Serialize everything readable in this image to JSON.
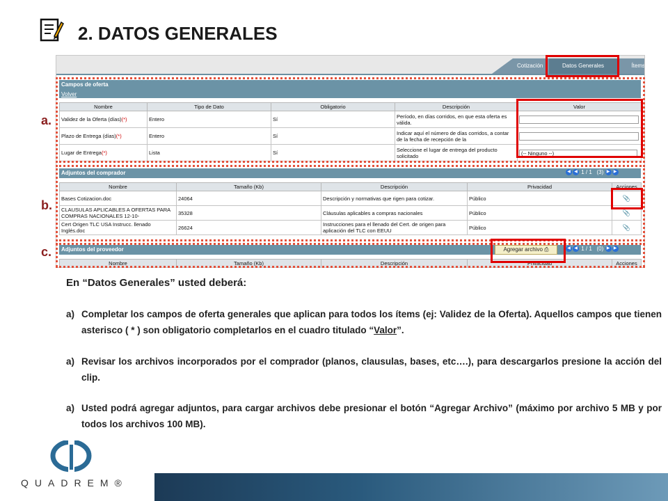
{
  "header": {
    "title": "2. DATOS GENERALES",
    "icon": "notepad-pencil-icon"
  },
  "tabs": {
    "cotizacion": "Cotización",
    "datos_generales": "Datos Generales",
    "items": "Ítems"
  },
  "campos": {
    "section_title": "Campos de oferta",
    "back_link": "Volver",
    "columns": [
      "Nombre",
      "Tipo de Dato",
      "Obligatorio",
      "Descripción",
      "Valor"
    ],
    "rows": [
      {
        "name": "Validez de la Oferta (días)",
        "req": "(*)",
        "type": "Entero",
        "mandatory": "Sí",
        "desc": "Período, en días corridos, en que esta oferta es válida.",
        "value": ""
      },
      {
        "name": "Plazo de Entrega (días)",
        "req": "(*)",
        "type": "Entero",
        "mandatory": "Sí",
        "desc": "Indicar aquí el número de días corridos, a contar de la fecha de recepción de la",
        "value": ""
      },
      {
        "name": "Lugar de Entrega",
        "req": "(*)",
        "type": "Lista",
        "mandatory": "Sí",
        "desc": "Seleccione el lugar de entrega del producto solicitado",
        "value": "(-- Ninguno --)"
      }
    ]
  },
  "adjuntos_comprador": {
    "section_title": "Adjuntos del comprador",
    "pager": "1 / 1",
    "count": "(3)",
    "columns": [
      "Nombre",
      "Tamaño (Kb)",
      "Descripción",
      "Privacidad",
      "Acciones"
    ],
    "rows": [
      {
        "name": "Bases Cotizacion.doc",
        "size": "24064",
        "desc": "Descripción y normativas que rigen para cotizar.",
        "privacy": "Público"
      },
      {
        "name": "CLAUSULAS APLICABLES A OFERTAS PARA COMPRAS NACIONALES 12-10-",
        "size": "35328",
        "desc": "Cláusulas aplicables a compras nacionales",
        "privacy": "Público"
      },
      {
        "name": "Cert Origen TLC USA Instrucc. llenado Inglés.doc",
        "size": "26624",
        "desc": "Instrucciones para el llenado del Cert. de origen para aplicación del TLC con EEUU",
        "privacy": "Público"
      }
    ]
  },
  "adjuntos_proveedor": {
    "section_title": "Adjuntos del proveedor",
    "add_button": "Agregar archivo",
    "pager": "1 / 1",
    "count": "(0)",
    "columns": [
      "Nombre",
      "Tamaño (Kb)",
      "Descripción",
      "Privacidad",
      "Acciones"
    ]
  },
  "labels": {
    "a": "a.",
    "b": "b.",
    "c": "c."
  },
  "content": {
    "subtitle": "En “Datos Generales” usted deberá:",
    "bullet_marker": "a)",
    "bullet1_pre": "Completar los campos de oferta generales que aplican para todos los ítems (ej: Validez de la Oferta). Aquellos campos que tienen asterisco ( * ) son obligatorio completarlos en el cuadro titulado “",
    "bullet1_link": "Valor",
    "bullet1_post": "”.",
    "bullet2": "Revisar los archivos incorporados por el comprador (planos, clausulas, bases, etc….), para descargarlos presione la acción del clip.",
    "bullet3": "Usted podrá agregar adjuntos, para cargar archivos debe presionar el botón “Agregar Archivo” (máximo por archivo 5 MB y por todos los archivos 100 MB)."
  },
  "footer": {
    "logo_text": "QUADREM®"
  },
  "colors": {
    "accent_red": "#e00000",
    "dotted": "#e3503a",
    "section_blue": "#6b93a6"
  }
}
